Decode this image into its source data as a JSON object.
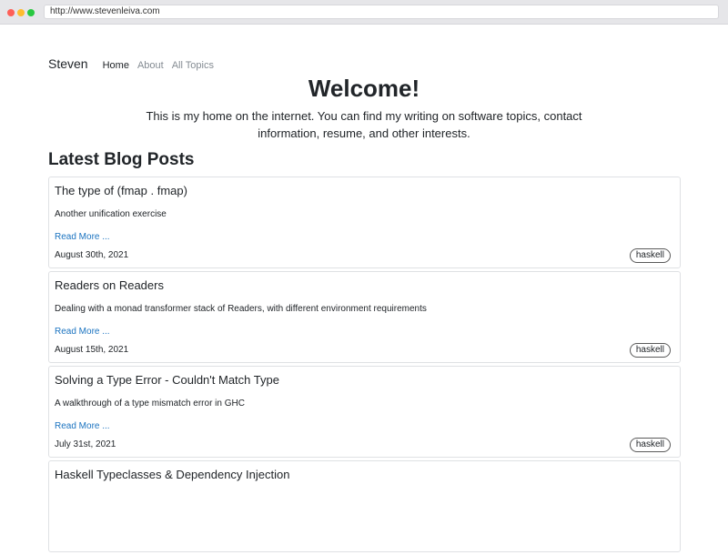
{
  "browser": {
    "url": "http://www.stevenleiva.com"
  },
  "nav": {
    "brand": "Steven",
    "links": [
      "Home",
      "About",
      "All Topics"
    ]
  },
  "hero": {
    "title": "Welcome!",
    "subtitle": "This is my home on the internet. You can find my writing on software topics, contact information, resume, and other interests."
  },
  "section_title": "Latest Blog Posts",
  "posts": [
    {
      "title": "The type of (fmap . fmap)",
      "description": "Another unification exercise",
      "read_more": "Read More ...",
      "date": "August 30th, 2021",
      "tag": "haskell"
    },
    {
      "title": "Readers on Readers",
      "description": "Dealing with a monad transformer stack of Readers, with different environment requirements",
      "read_more": "Read More ...",
      "date": "August 15th, 2021",
      "tag": "haskell"
    },
    {
      "title": "Solving a Type Error - Couldn't Match Type",
      "description": "A walkthrough of a type mismatch error in GHC",
      "read_more": "Read More ...",
      "date": "July 31st, 2021",
      "tag": "haskell"
    },
    {
      "title": "Haskell Typeclasses & Dependency Injection"
    }
  ]
}
